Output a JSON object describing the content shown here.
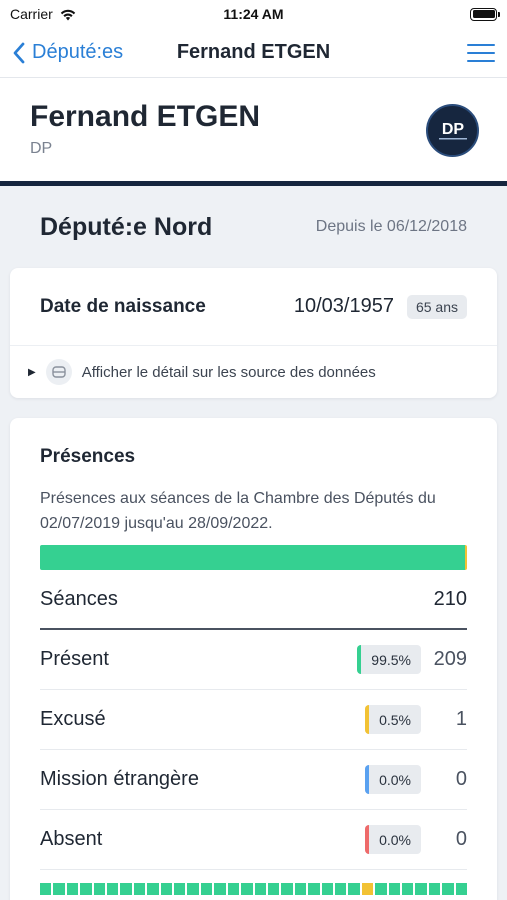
{
  "status_bar": {
    "carrier": "Carrier",
    "time": "11:24 AM"
  },
  "nav": {
    "back_label": "Député:es",
    "title": "Fernand ETGEN"
  },
  "profile": {
    "name": "Fernand ETGEN",
    "party": "DP",
    "logo_text": "DP"
  },
  "district": {
    "title": "Député:e Nord",
    "since": "Depuis le 06/12/2018"
  },
  "birth": {
    "label": "Date de naissance",
    "date": "10/03/1957",
    "age": "65 ans",
    "source_link": "Afficher le détail sur les source des données"
  },
  "presences": {
    "title": "Présences",
    "description": "Présences aux séances de la Chambre des Députés du 02/07/2019 jusqu'au 28/09/2022.",
    "total_label": "Séances",
    "total": "210",
    "colors": {
      "present": "#35d091",
      "excused": "#f2c234",
      "mission": "#5aa1f0",
      "absent": "#ee6a6a"
    },
    "rows": [
      {
        "label": "Présent",
        "percent": "99.5%",
        "count": "209",
        "color": "#35d091",
        "share": 0.995
      },
      {
        "label": "Excusé",
        "percent": "0.5%",
        "count": "1",
        "color": "#f2c234",
        "share": 0.005
      },
      {
        "label": "Mission étrangère",
        "percent": "0.0%",
        "count": "0",
        "color": "#5aa1f0",
        "share": 0.0
      },
      {
        "label": "Absent",
        "percent": "0.0%",
        "count": "0",
        "color": "#ee6a6a",
        "share": 0.0
      }
    ]
  }
}
